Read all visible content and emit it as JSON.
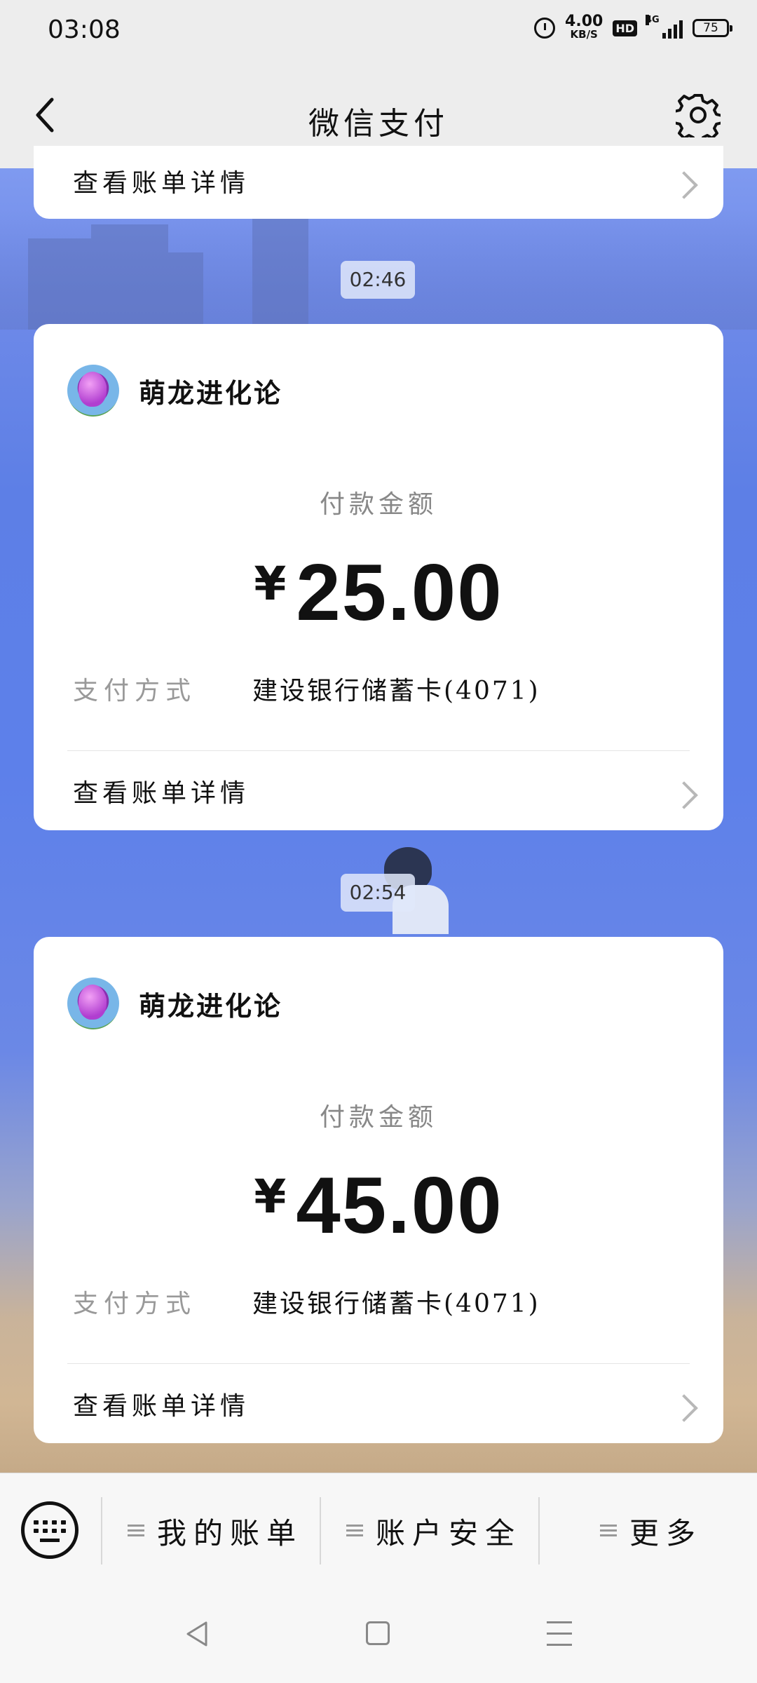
{
  "status_bar": {
    "time": "03:08",
    "speed_value": "4.00",
    "speed_unit": "KB/S",
    "hd": "HD",
    "network": "4G",
    "battery": "75"
  },
  "header": {
    "title": "微信支付"
  },
  "partial_card": {
    "detail_label": "查看账单详情"
  },
  "messages": [
    {
      "timestamp": "02:46",
      "merchant": "萌龙进化论",
      "amount_label": "付款金额",
      "currency": "¥",
      "amount": "25.00",
      "method_label": "支付方式",
      "method_value": "建设银行储蓄卡(4071)",
      "detail_label": "查看账单详情"
    },
    {
      "timestamp": "02:54",
      "merchant": "萌龙进化论",
      "amount_label": "付款金额",
      "currency": "¥",
      "amount": "45.00",
      "method_label": "支付方式",
      "method_value": "建设银行储蓄卡(4071)",
      "detail_label": "查看账单详情"
    }
  ],
  "bottom_menu": {
    "items": [
      "我的账单",
      "账户安全",
      "更多"
    ]
  },
  "icons": {
    "back": "back-arrow-icon",
    "settings": "gear-icon",
    "keyboard": "keyboard-icon",
    "menu": "menu-icon"
  }
}
